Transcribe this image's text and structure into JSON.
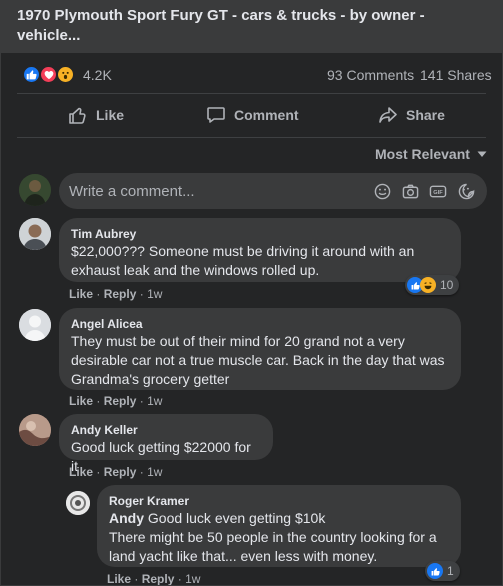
{
  "post": {
    "link_title": "1970 Plymouth Sport Fury GT - cars & trucks - by owner - vehicle...",
    "reaction_count": "4.2K",
    "comments_count": "93 Comments",
    "shares_count": "141 Shares"
  },
  "actions": {
    "like": "Like",
    "comment": "Comment",
    "share": "Share"
  },
  "sort": {
    "label": "Most Relevant"
  },
  "composer": {
    "placeholder": "Write a comment..."
  },
  "comments": [
    {
      "author": "Tim Aubrey",
      "text": "$22,000??? Someone must be driving it around with an exhaust leak and the windows rolled up.",
      "like_label": "Like",
      "reply_label": "Reply",
      "time": "1w",
      "reaction_count": "10"
    },
    {
      "author": "Angel Alicea",
      "text": "They must be out of their mind for 20 grand not a very desirable car not a true muscle car. Back in the day that was Grandma's grocery getter",
      "like_label": "Like",
      "reply_label": "Reply",
      "time": "1w"
    },
    {
      "author": "Andy Keller",
      "text": "Good luck getting $22000 for it",
      "like_label": "Like",
      "reply_label": "Reply",
      "time": "1w"
    },
    {
      "author": "Roger Kramer",
      "mention": "Andy",
      "text": " Good luck even getting $10k",
      "text2": "There might be 50 people in the country looking for a land yacht like that... even less with money.",
      "like_label": "Like",
      "reply_label": "Reply",
      "time": "1w",
      "reaction_count": "1"
    }
  ],
  "separator": "·",
  "colors": {
    "background": "#242526",
    "bubble": "#3a3b3c",
    "like_blue": "#1877f2",
    "love_red": "#f33e58",
    "wow_yellow": "#f7b125",
    "secondary_text": "#b0b3b8"
  }
}
